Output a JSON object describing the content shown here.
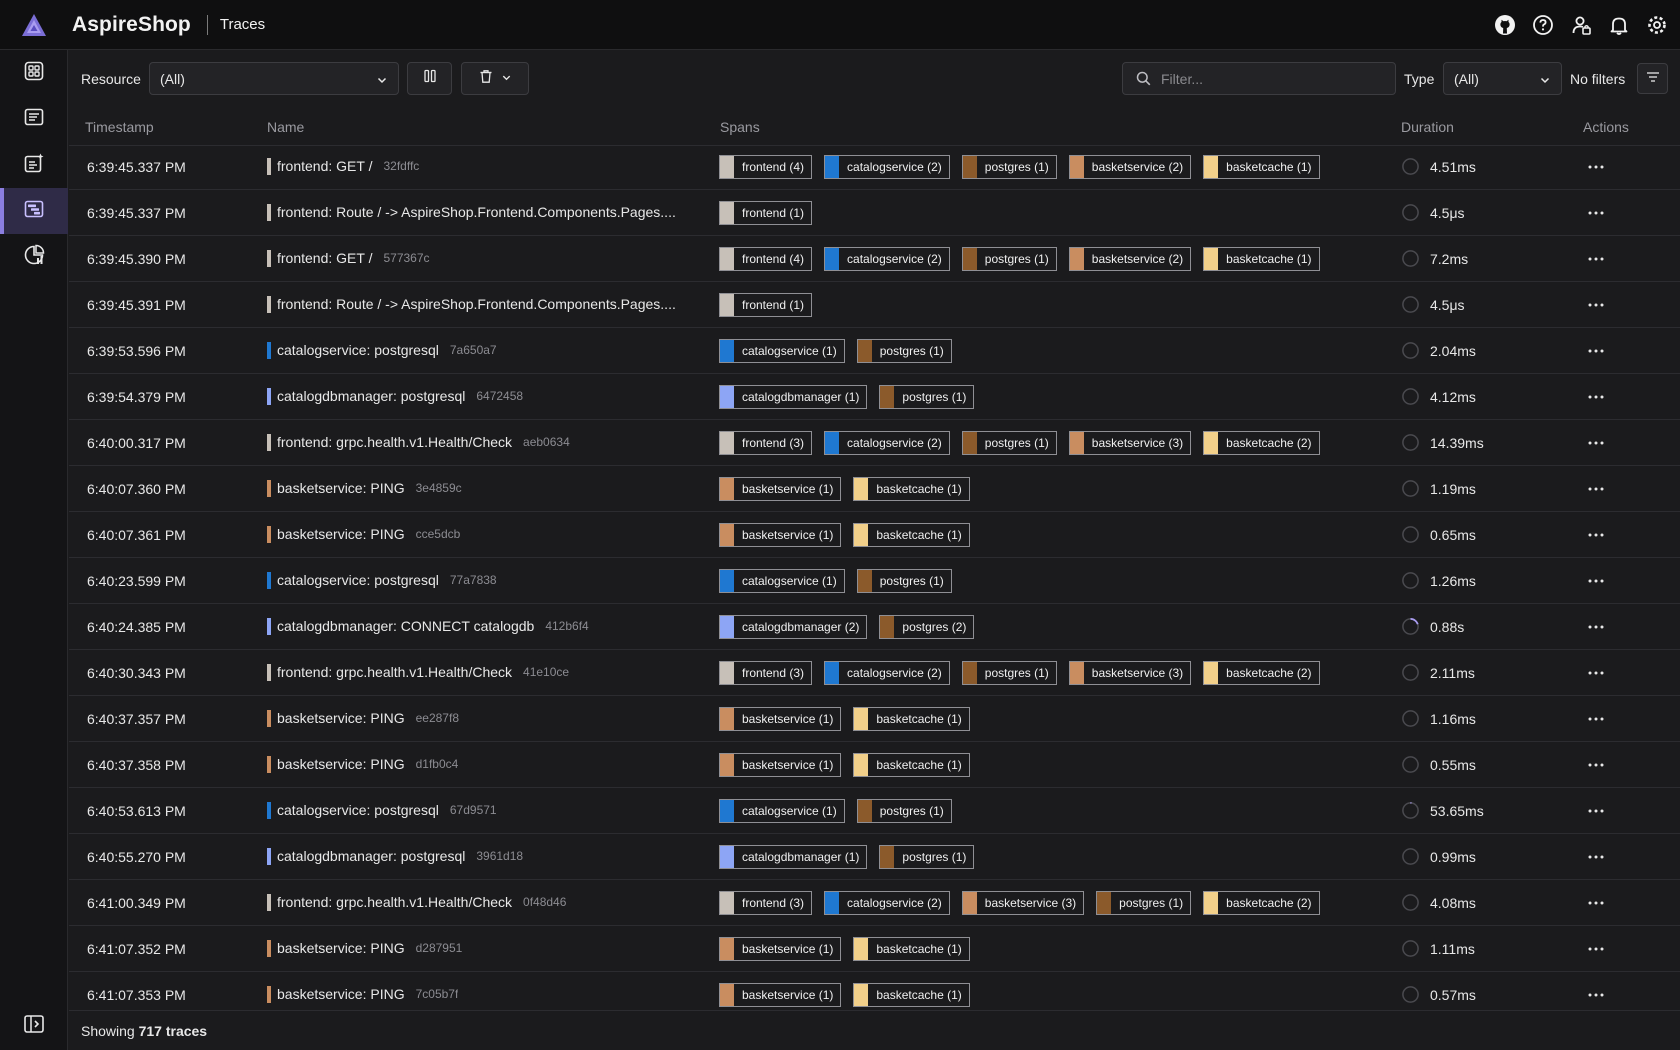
{
  "header": {
    "app_name": "AspireShop",
    "page_title": "Traces"
  },
  "toolbar": {
    "resource_label": "Resource",
    "resource_value": "(All)",
    "filter_placeholder": "Filter...",
    "type_label": "Type",
    "type_value": "(All)",
    "no_filters_label": "No filters"
  },
  "table": {
    "columns": {
      "timestamp": "Timestamp",
      "name": "Name",
      "spans": "Spans",
      "duration": "Duration",
      "actions": "Actions"
    }
  },
  "resource_colors": {
    "frontend": "#c7c0b8",
    "catalogservice": "#1f78d1",
    "postgres": "#8b5a2b",
    "basketservice": "#c98d60",
    "basketcache": "#f2d08a",
    "catalogdbmanager": "#8da5f5"
  },
  "rows": [
    {
      "timestamp": "6:39:45.337 PM",
      "name": "frontend: GET /",
      "trace_id": "32fdffc",
      "name_color": "#c7c0b8",
      "duration": "4.51ms",
      "progress": 0,
      "spans": [
        {
          "label": "frontend (4)",
          "color": "#c7c0b8"
        },
        {
          "label": "catalogservice (2)",
          "color": "#1f78d1"
        },
        {
          "label": "postgres (1)",
          "color": "#8b5a2b"
        },
        {
          "label": "basketservice (2)",
          "color": "#c98d60"
        },
        {
          "label": "basketcache (1)",
          "color": "#f2d08a"
        }
      ]
    },
    {
      "timestamp": "6:39:45.337 PM",
      "name": "frontend: Route / -> AspireShop.Frontend.Components.Pages....",
      "trace_id": "",
      "name_color": "#c7c0b8",
      "duration": "4.5μs",
      "progress": 0,
      "spans": [
        {
          "label": "frontend (1)",
          "color": "#c7c0b8"
        }
      ]
    },
    {
      "timestamp": "6:39:45.390 PM",
      "name": "frontend: GET /",
      "trace_id": "577367c",
      "name_color": "#c7c0b8",
      "duration": "7.2ms",
      "progress": 0,
      "spans": [
        {
          "label": "frontend (4)",
          "color": "#c7c0b8"
        },
        {
          "label": "catalogservice (2)",
          "color": "#1f78d1"
        },
        {
          "label": "postgres (1)",
          "color": "#8b5a2b"
        },
        {
          "label": "basketservice (2)",
          "color": "#c98d60"
        },
        {
          "label": "basketcache (1)",
          "color": "#f2d08a"
        }
      ]
    },
    {
      "timestamp": "6:39:45.391 PM",
      "name": "frontend: Route / -> AspireShop.Frontend.Components.Pages....",
      "trace_id": "",
      "name_color": "#c7c0b8",
      "duration": "4.5μs",
      "progress": 0,
      "spans": [
        {
          "label": "frontend (1)",
          "color": "#c7c0b8"
        }
      ]
    },
    {
      "timestamp": "6:39:53.596 PM",
      "name": "catalogservice: postgresql",
      "trace_id": "7a650a7",
      "name_color": "#1f78d1",
      "duration": "2.04ms",
      "progress": 0,
      "spans": [
        {
          "label": "catalogservice (1)",
          "color": "#1f78d1"
        },
        {
          "label": "postgres (1)",
          "color": "#8b5a2b"
        }
      ]
    },
    {
      "timestamp": "6:39:54.379 PM",
      "name": "catalogdbmanager: postgresql",
      "trace_id": "6472458",
      "name_color": "#8da5f5",
      "duration": "4.12ms",
      "progress": 0,
      "spans": [
        {
          "label": "catalogdbmanager (1)",
          "color": "#8da5f5"
        },
        {
          "label": "postgres (1)",
          "color": "#8b5a2b"
        }
      ]
    },
    {
      "timestamp": "6:40:00.317 PM",
      "name": "frontend: grpc.health.v1.Health/Check",
      "trace_id": "aeb0634",
      "name_color": "#c7c0b8",
      "duration": "14.39ms",
      "progress": 0,
      "spans": [
        {
          "label": "frontend (3)",
          "color": "#c7c0b8"
        },
        {
          "label": "catalogservice (2)",
          "color": "#1f78d1"
        },
        {
          "label": "postgres (1)",
          "color": "#8b5a2b"
        },
        {
          "label": "basketservice (3)",
          "color": "#c98d60"
        },
        {
          "label": "basketcache (2)",
          "color": "#f2d08a"
        }
      ]
    },
    {
      "timestamp": "6:40:07.360 PM",
      "name": "basketservice: PING",
      "trace_id": "3e4859c",
      "name_color": "#c98d60",
      "duration": "1.19ms",
      "progress": 0,
      "spans": [
        {
          "label": "basketservice (1)",
          "color": "#c98d60"
        },
        {
          "label": "basketcache (1)",
          "color": "#f2d08a"
        }
      ]
    },
    {
      "timestamp": "6:40:07.361 PM",
      "name": "basketservice: PING",
      "trace_id": "cce5dcb",
      "name_color": "#c98d60",
      "duration": "0.65ms",
      "progress": 0,
      "spans": [
        {
          "label": "basketservice (1)",
          "color": "#c98d60"
        },
        {
          "label": "basketcache (1)",
          "color": "#f2d08a"
        }
      ]
    },
    {
      "timestamp": "6:40:23.599 PM",
      "name": "catalogservice: postgresql",
      "trace_id": "77a7838",
      "name_color": "#1f78d1",
      "duration": "1.26ms",
      "progress": 0,
      "spans": [
        {
          "label": "catalogservice (1)",
          "color": "#1f78d1"
        },
        {
          "label": "postgres (1)",
          "color": "#8b5a2b"
        }
      ]
    },
    {
      "timestamp": "6:40:24.385 PM",
      "name": "catalogdbmanager: CONNECT catalogdb",
      "trace_id": "412b6f4",
      "name_color": "#8da5f5",
      "duration": "0.88s",
      "progress": 0.2,
      "spans": [
        {
          "label": "catalogdbmanager (2)",
          "color": "#8da5f5"
        },
        {
          "label": "postgres (2)",
          "color": "#8b5a2b"
        }
      ]
    },
    {
      "timestamp": "6:40:30.343 PM",
      "name": "frontend: grpc.health.v1.Health/Check",
      "trace_id": "41e10ce",
      "name_color": "#c7c0b8",
      "duration": "2.11ms",
      "progress": 0,
      "spans": [
        {
          "label": "frontend (3)",
          "color": "#c7c0b8"
        },
        {
          "label": "catalogservice (2)",
          "color": "#1f78d1"
        },
        {
          "label": "postgres (1)",
          "color": "#8b5a2b"
        },
        {
          "label": "basketservice (3)",
          "color": "#c98d60"
        },
        {
          "label": "basketcache (2)",
          "color": "#f2d08a"
        }
      ]
    },
    {
      "timestamp": "6:40:37.357 PM",
      "name": "basketservice: PING",
      "trace_id": "ee287f8",
      "name_color": "#c98d60",
      "duration": "1.16ms",
      "progress": 0,
      "spans": [
        {
          "label": "basketservice (1)",
          "color": "#c98d60"
        },
        {
          "label": "basketcache (1)",
          "color": "#f2d08a"
        }
      ]
    },
    {
      "timestamp": "6:40:37.358 PM",
      "name": "basketservice: PING",
      "trace_id": "d1fb0c4",
      "name_color": "#c98d60",
      "duration": "0.55ms",
      "progress": 0,
      "spans": [
        {
          "label": "basketservice (1)",
          "color": "#c98d60"
        },
        {
          "label": "basketcache (1)",
          "color": "#f2d08a"
        }
      ]
    },
    {
      "timestamp": "6:40:53.613 PM",
      "name": "catalogservice: postgresql",
      "trace_id": "67d9571",
      "name_color": "#1f78d1",
      "duration": "53.65ms",
      "progress": 0.02,
      "spans": [
        {
          "label": "catalogservice (1)",
          "color": "#1f78d1"
        },
        {
          "label": "postgres (1)",
          "color": "#8b5a2b"
        }
      ]
    },
    {
      "timestamp": "6:40:55.270 PM",
      "name": "catalogdbmanager: postgresql",
      "trace_id": "3961d18",
      "name_color": "#8da5f5",
      "duration": "0.99ms",
      "progress": 0,
      "spans": [
        {
          "label": "catalogdbmanager (1)",
          "color": "#8da5f5"
        },
        {
          "label": "postgres (1)",
          "color": "#8b5a2b"
        }
      ]
    },
    {
      "timestamp": "6:41:00.349 PM",
      "name": "frontend: grpc.health.v1.Health/Check",
      "trace_id": "0f48d46",
      "name_color": "#c7c0b8",
      "duration": "4.08ms",
      "progress": 0,
      "spans": [
        {
          "label": "frontend (3)",
          "color": "#c7c0b8"
        },
        {
          "label": "catalogservice (2)",
          "color": "#1f78d1"
        },
        {
          "label": "basketservice (3)",
          "color": "#c98d60"
        },
        {
          "label": "postgres (1)",
          "color": "#8b5a2b"
        },
        {
          "label": "basketcache (2)",
          "color": "#f2d08a"
        }
      ]
    },
    {
      "timestamp": "6:41:07.352 PM",
      "name": "basketservice: PING",
      "trace_id": "d287951",
      "name_color": "#c98d60",
      "duration": "1.11ms",
      "progress": 0,
      "spans": [
        {
          "label": "basketservice (1)",
          "color": "#c98d60"
        },
        {
          "label": "basketcache (1)",
          "color": "#f2d08a"
        }
      ]
    },
    {
      "timestamp": "6:41:07.353 PM",
      "name": "basketservice: PING",
      "trace_id": "7c05b7f",
      "name_color": "#c98d60",
      "duration": "0.57ms",
      "progress": 0,
      "spans": [
        {
          "label": "basketservice (1)",
          "color": "#c98d60"
        },
        {
          "label": "basketcache (1)",
          "color": "#f2d08a"
        }
      ]
    }
  ],
  "footer": {
    "showing_prefix": "Showing",
    "count_text": "717 traces"
  },
  "icons": {
    "top": [
      "github-icon",
      "help-icon",
      "account-icon",
      "notifications-icon",
      "settings-icon"
    ],
    "nav": [
      "resources-icon",
      "console-logs-icon",
      "structured-logs-icon",
      "traces-icon",
      "metrics-icon"
    ],
    "nav_bottom": "collapse-nav-icon"
  }
}
